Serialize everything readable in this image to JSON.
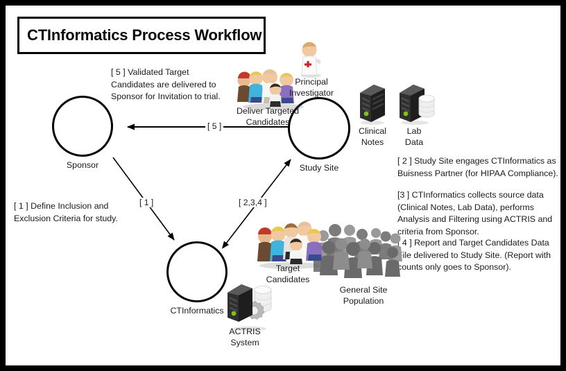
{
  "diagram": {
    "title": "CTInformatics Process Workflow",
    "nodes": [
      {
        "id": "sponsor",
        "label": "Sponsor"
      },
      {
        "id": "study-site",
        "label": "Study Site"
      },
      {
        "id": "ctinformatics",
        "label": "CTInformatics"
      }
    ],
    "icons": [
      {
        "id": "deliver-targeted-candidates",
        "label": "Deliver Targeted\nCandidates",
        "kind": "people-color"
      },
      {
        "id": "principal-investigator",
        "label": "Principal\nInvestigator",
        "kind": "doctor"
      },
      {
        "id": "clinical-notes",
        "label": "Clinical\nNotes",
        "kind": "server"
      },
      {
        "id": "lab-data",
        "label": "Lab\nData",
        "kind": "server-db"
      },
      {
        "id": "target-candidates",
        "label": "Target\nCandidates",
        "kind": "people-color"
      },
      {
        "id": "general-site-population",
        "label": "General Site\nPopulation",
        "kind": "people-gray"
      },
      {
        "id": "actris-system",
        "label": "ACTRIS\nSystem",
        "kind": "server-gear-db"
      }
    ],
    "edges": [
      {
        "id": "edge-5",
        "label": "[ 5 ]",
        "from": "study-site",
        "to": "sponsor",
        "style": "single-arrow"
      },
      {
        "id": "edge-1",
        "label": "[ 1 ]",
        "from": "sponsor",
        "to": "ctinformatics",
        "style": "single-arrow"
      },
      {
        "id": "edge-2-3-4",
        "label": "[ 2,3,4 ]",
        "from": "ctinformatics",
        "to": "study-site",
        "style": "double-arrow"
      }
    ],
    "notes": [
      {
        "id": "note-5",
        "text": "[ 5 ] Validated Target\nCandidates are delivered to\nSponsor for Invitation to trial."
      },
      {
        "id": "note-1",
        "text": "[ 1 ] Define Inclusion and\nExclusion Criteria for study."
      },
      {
        "id": "note-2",
        "text": "[ 2 ] Study Site engages CTInformatics as\nBuisness Partner (for HIPAA Compliance)."
      },
      {
        "id": "note-3",
        "text": "[3 ] CTInformatics collects source data\n(Clinical Notes, Lab Data), performs\nAnalysis and Filtering using ACTRIS and\ncriteria from Sponsor."
      },
      {
        "id": "note-4",
        "text": "[ 4 ] Report and Target Candidates Data\nFile delivered to Study Site.  (Report with\ncounts only goes to Sponsor)."
      }
    ],
    "colors": {
      "frame": "#000000",
      "sheet": "#ffffff",
      "stroke": "#000000",
      "text": "#1a1a1a",
      "skin": "#f0c9a0",
      "server_dark": "#2b2b2b",
      "server_led": "#7fc21a",
      "crowd_gray": "#808080",
      "red_cross": "#d32222"
    }
  }
}
